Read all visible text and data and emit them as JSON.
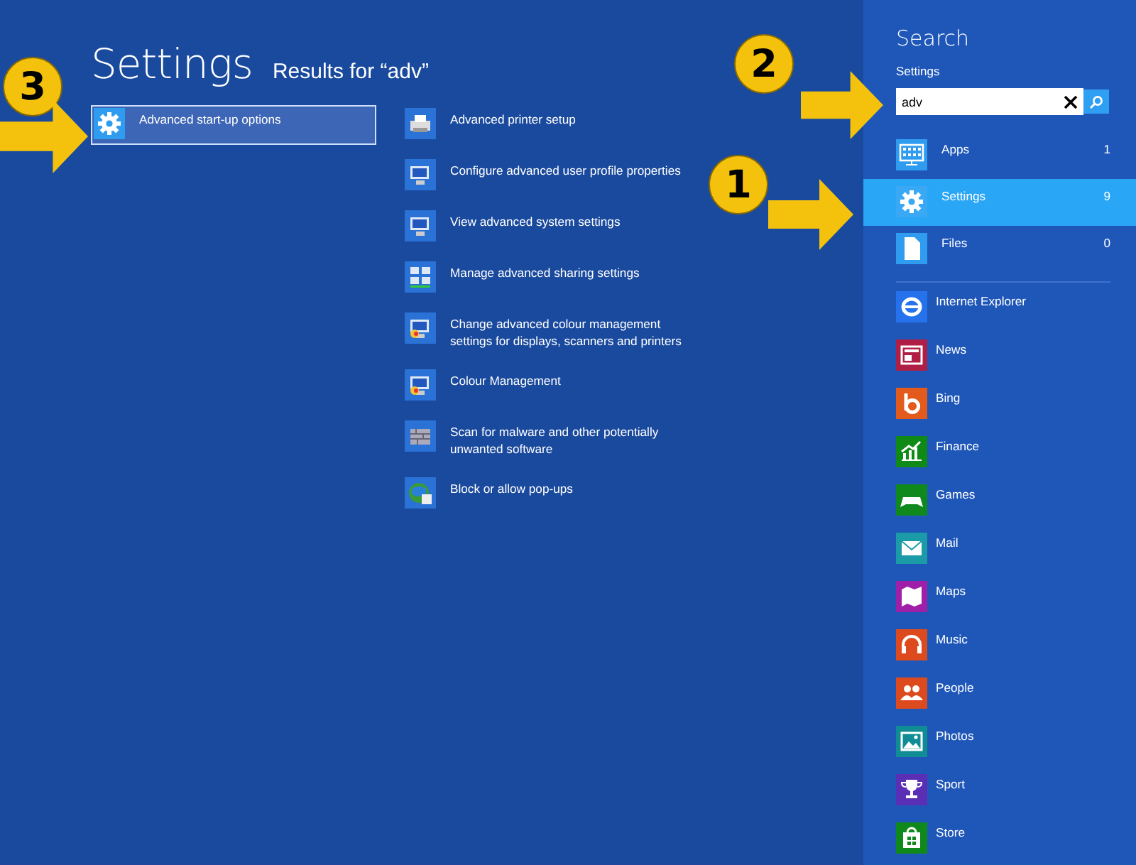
{
  "results_view": {
    "title": "Settings",
    "subtitle": "Results for “adv”",
    "results": [
      {
        "label": "Advanced start-up options",
        "selected": true
      },
      {
        "label": "Advanced printer setup",
        "selected": false
      },
      {
        "label": "Configure advanced user profile properties",
        "selected": false
      },
      {
        "label": "View advanced system settings",
        "selected": false
      },
      {
        "label": "Manage advanced sharing settings",
        "selected": false
      },
      {
        "label": "Change advanced colour management settings for displays, scanners and printers",
        "selected": false
      },
      {
        "label": "Colour Management",
        "selected": false
      },
      {
        "label": "Scan for malware and other potentially unwanted software",
        "selected": false
      },
      {
        "label": "Block or allow pop-ups",
        "selected": false
      }
    ]
  },
  "search_pane": {
    "title": "Search",
    "scope": "Settings",
    "search": {
      "value": "adv"
    },
    "categories": [
      {
        "label": "Apps",
        "count": "1",
        "selected": false
      },
      {
        "label": "Settings",
        "count": "9",
        "selected": true
      },
      {
        "label": "Files",
        "count": "0",
        "selected": false
      }
    ],
    "apps": [
      {
        "label": "Internet Explorer",
        "color": "#2672ec"
      },
      {
        "label": "News",
        "color": "#b01e45"
      },
      {
        "label": "Bing",
        "color": "#e25a1c"
      },
      {
        "label": "Finance",
        "color": "#0f8a17"
      },
      {
        "label": "Games",
        "color": "#10891c"
      },
      {
        "label": "Mail",
        "color": "#1a9ba7"
      },
      {
        "label": "Maps",
        "color": "#a01fa8"
      },
      {
        "label": "Music",
        "color": "#dc4a1e"
      },
      {
        "label": "People",
        "color": "#dc4a1e"
      },
      {
        "label": "Photos",
        "color": "#0f8c94"
      },
      {
        "label": "Sport",
        "color": "#5b2fb5"
      },
      {
        "label": "Store",
        "color": "#10891c"
      }
    ]
  },
  "annotations": [
    {
      "label": "3"
    },
    {
      "label": "2"
    },
    {
      "label": "1"
    }
  ]
}
